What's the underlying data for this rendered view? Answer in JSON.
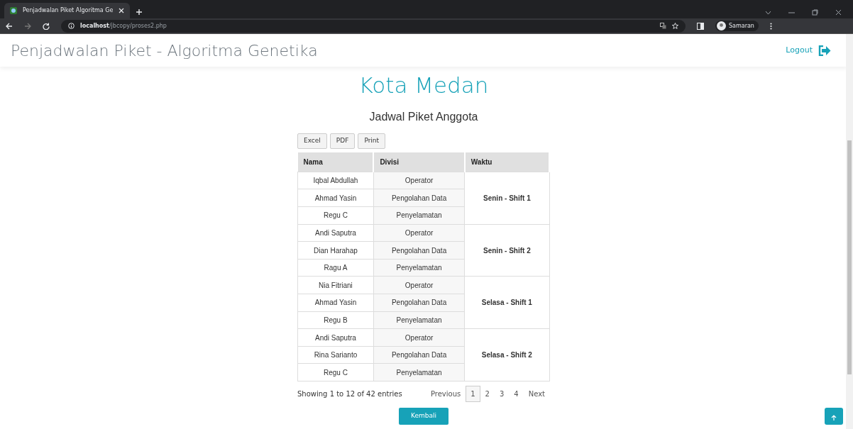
{
  "browser": {
    "tab_title": "Penjadwalan Piket Algoritma Ge",
    "url_host": "localhost",
    "url_path": "/jbcopy/proses2.php",
    "profile": "Samaran"
  },
  "navbar": {
    "brand": "Penjadwalan Piket - Algoritma Genetika",
    "logout": "Logout"
  },
  "title": "Kota Medan",
  "subtitle": "Jadwal Piket Anggota",
  "export_buttons": [
    "Excel",
    "PDF",
    "Print"
  ],
  "table": {
    "columns": [
      "Nama",
      "Divisi",
      "Waktu"
    ],
    "groups": [
      {
        "waktu": "Senin - Shift 1",
        "rows": [
          {
            "nama": "Iqbal Abdullah",
            "divisi": "Operator"
          },
          {
            "nama": "Ahmad Yasin",
            "divisi": "Pengolahan Data"
          },
          {
            "nama": "Regu C",
            "divisi": "Penyelamatan"
          }
        ]
      },
      {
        "waktu": "Senin - Shift 2",
        "rows": [
          {
            "nama": "Andi Saputra",
            "divisi": "Operator"
          },
          {
            "nama": "Dian Harahap",
            "divisi": "Pengolahan Data"
          },
          {
            "nama": "Ragu A",
            "divisi": "Penyelamatan"
          }
        ]
      },
      {
        "waktu": "Selasa - Shift 1",
        "rows": [
          {
            "nama": "Nia Fitriani",
            "divisi": "Operator"
          },
          {
            "nama": "Ahmad Yasin",
            "divisi": "Pengolahan Data"
          },
          {
            "nama": "Regu B",
            "divisi": "Penyelamatan"
          }
        ]
      },
      {
        "waktu": "Selasa - Shift 2",
        "rows": [
          {
            "nama": "Andi Saputra",
            "divisi": "Operator"
          },
          {
            "nama": "Rina Sarianto",
            "divisi": "Pengolahan Data"
          },
          {
            "nama": "Regu C",
            "divisi": "Penyelamatan"
          }
        ]
      }
    ]
  },
  "pagination": {
    "info": "Showing 1 to 12 of 42 entries",
    "previous": "Previous",
    "pages": [
      {
        "label": "1",
        "selected": true
      },
      {
        "label": "2",
        "selected": false
      },
      {
        "label": "3",
        "selected": false
      },
      {
        "label": "4",
        "selected": false
      }
    ],
    "next": "Next"
  },
  "back_button": "Kembali"
}
